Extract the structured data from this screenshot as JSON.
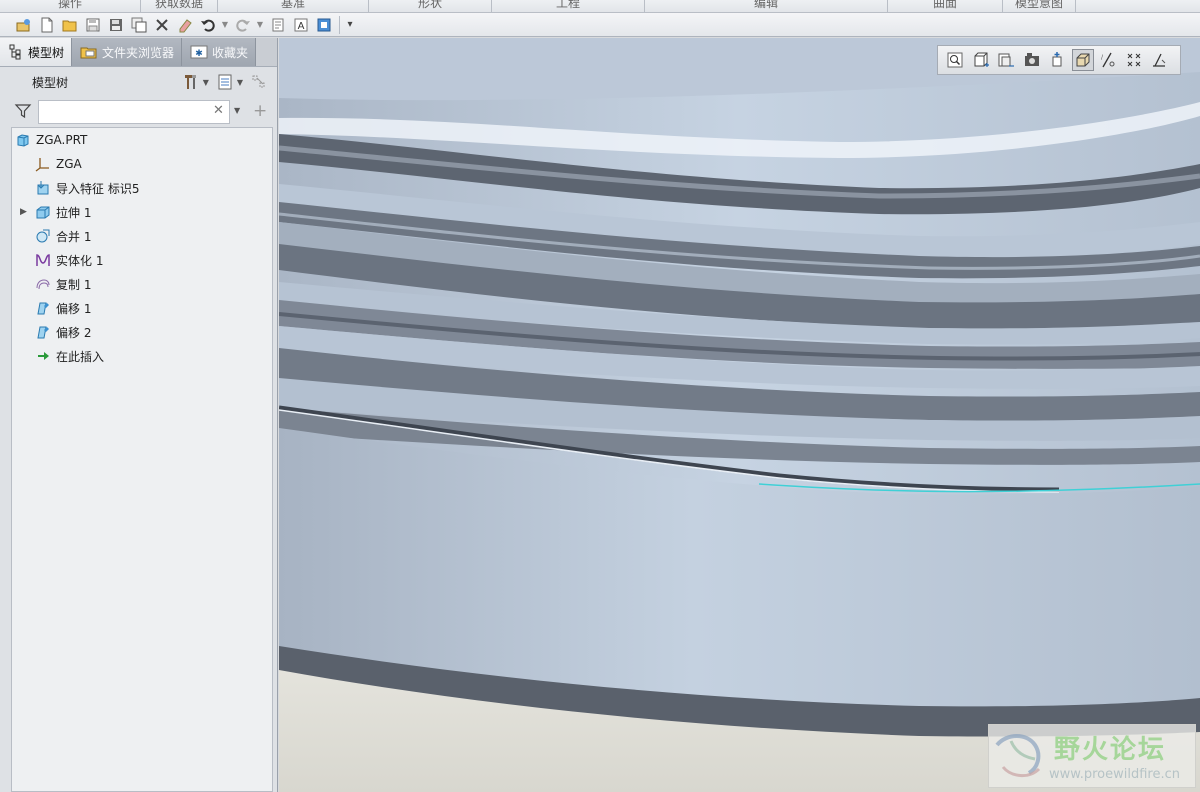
{
  "ribbon": {
    "groups": [
      "操作",
      "获取数据",
      "基准",
      "形状",
      "工程",
      "编辑",
      "曲面",
      "模型意图"
    ]
  },
  "left_panel": {
    "tabs": [
      {
        "label": "模型树",
        "icon": "model-tree-icon",
        "active": true
      },
      {
        "label": "文件夹浏览器",
        "icon": "folder-browser-icon",
        "active": false
      },
      {
        "label": "收藏夹",
        "icon": "favorites-icon",
        "active": false
      }
    ],
    "model_tree": {
      "title": "模型树",
      "search": {
        "value": "",
        "placeholder": ""
      },
      "items": [
        {
          "label": "ZGA.PRT",
          "icon": "part-icon"
        },
        {
          "label": "ZGA",
          "icon": "coordinate-system-icon"
        },
        {
          "label": "导入特征 标识5",
          "icon": "import-feature-icon"
        },
        {
          "label": "拉伸 1",
          "icon": "extrude-icon",
          "expandable": true
        },
        {
          "label": "合并 1",
          "icon": "merge-icon"
        },
        {
          "label": "实体化 1",
          "icon": "solidify-icon"
        },
        {
          "label": "复制 1",
          "icon": "copy-icon"
        },
        {
          "label": "偏移 1",
          "icon": "offset-icon"
        },
        {
          "label": "偏移 2",
          "icon": "offset-icon"
        },
        {
          "label": "在此插入",
          "icon": "insert-here-icon"
        }
      ]
    }
  },
  "view_toolbar": {
    "buttons": [
      "refit-icon",
      "zoom-in-icon",
      "zoom-out-icon",
      "saved-views-icon",
      "view-manager-icon",
      "display-style-icon",
      "datum-display-icon",
      "spin-center-icon",
      "annotation-display-icon"
    ],
    "active_index": 5
  },
  "watermark": {
    "title": "野火论坛",
    "url": "www.proewildfire.cn"
  },
  "colors": {
    "accent_selection": "#3fd0d6",
    "panel_bg": "#dee1e5",
    "tree_bg": "#eef0f2",
    "viewport_floor": "#e1e0d8"
  }
}
